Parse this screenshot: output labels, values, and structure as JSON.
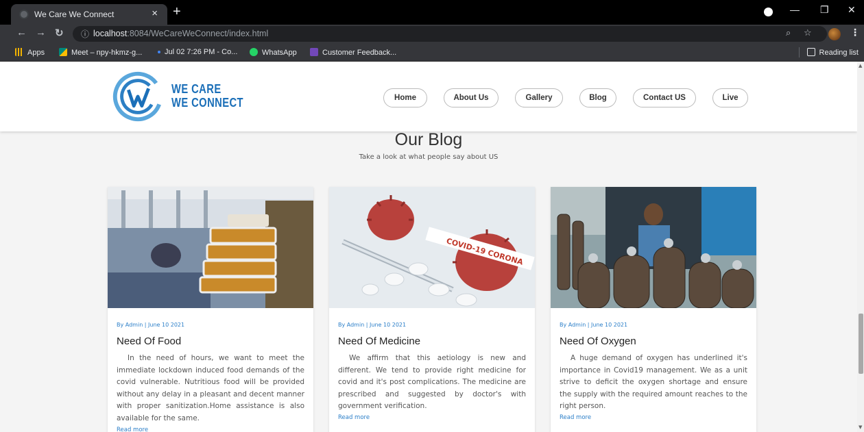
{
  "browser": {
    "tab_title": "We Care We Connect",
    "tab_close": "×",
    "new_tab": "+",
    "url_host": "localhost",
    "url_rest": ":8084/WeCareWeConnect/index.html",
    "icons": [
      "back-icon",
      "forward-icon",
      "reload-icon",
      "info-icon",
      "zoom-icon",
      "star-icon",
      "avatar",
      "menu-icon"
    ],
    "bookmarks": [
      {
        "label": "Apps",
        "icon": "apps-grid-icon",
        "color": "#f4b400"
      },
      {
        "label": "Meet – npy-hkmz-g...",
        "icon": "meet-icon",
        "color": "#00897b"
      },
      {
        "label": "Jul 02 7:26 PM - Co...",
        "icon": "dot-icon",
        "color": "#4285f4"
      },
      {
        "label": "WhatsApp",
        "icon": "whatsapp-icon",
        "color": "#25d366"
      },
      {
        "label": "Customer Feedback...",
        "icon": "forms-icon",
        "color": "#7248b9"
      }
    ],
    "reading_list": "Reading list"
  },
  "site": {
    "logo_line1": "WE CARE",
    "logo_line2": "WE CONNECT",
    "nav": [
      "Home",
      "About Us",
      "Gallery",
      "Blog",
      "Contact US",
      "Live"
    ]
  },
  "blog": {
    "title": "Our Blog",
    "subtitle": "Take a look at what people say about US",
    "posts": [
      {
        "meta": "By Admin | June 10 2021",
        "title": "Need Of Food",
        "body": "In the need of hours, we want to meet the immediate lockdown induced food demands of the covid vulnerable. Nutritious food will be provided without any delay in a pleasant and decent manner with proper sanitization.Home assistance is also available for the same.",
        "more": "Read more",
        "image": "food-packets-photo"
      },
      {
        "meta": "By Admin | June 10 2021",
        "title": "Need Of Medicine",
        "body": "We affirm that this aetiology is new and different. We tend to provide right medicine for covid and it's post complications. The medicine are prescribed and suggested by doctor's with government verification.",
        "more": "Read more",
        "image": "covid-medicine-photo"
      },
      {
        "meta": "By Admin | June 10 2021",
        "title": "Need Of Oxygen",
        "body": "A huge demand of oxygen has underlined it's importance in Covid19 management. We as a unit strive to deficit the oxygen shortage and ensure the supply with the required amount reaches to the right person.",
        "more": "Read more",
        "image": "oxygen-cylinders-photo"
      }
    ]
  },
  "colors": {
    "brand": "#1b6fb8",
    "link": "#2a7ec8",
    "page_bg": "#f4f4f4"
  }
}
